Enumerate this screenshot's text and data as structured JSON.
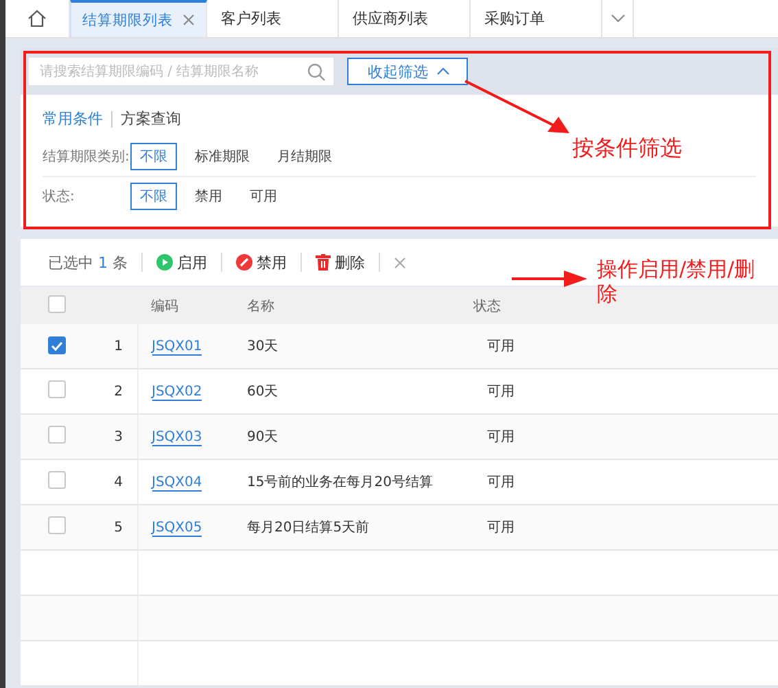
{
  "tabs": [
    {
      "label": "结算期限列表",
      "selected": true,
      "closable": true
    },
    {
      "label": "客户列表",
      "selected": false,
      "closable": false
    },
    {
      "label": "供应商列表",
      "selected": false,
      "closable": false
    },
    {
      "label": "采购订单",
      "selected": false,
      "closable": false
    }
  ],
  "search": {
    "placeholder": "请搜索结算期限编码 / 结算期限名称"
  },
  "collapse_button": "收起筛选",
  "filter_tabs": [
    {
      "label": "常用条件",
      "selected": true
    },
    {
      "label": "方案查询",
      "selected": false
    }
  ],
  "filters": [
    {
      "label": "结算期限类别:",
      "options": [
        {
          "label": "不限",
          "selected": true
        },
        {
          "label": "标准期限",
          "selected": false
        },
        {
          "label": "月结期限",
          "selected": false
        }
      ]
    },
    {
      "label": "状态:",
      "options": [
        {
          "label": "不限",
          "selected": true
        },
        {
          "label": "禁用",
          "selected": false
        },
        {
          "label": "可用",
          "selected": false
        }
      ]
    }
  ],
  "selection": {
    "prefix": "已选中",
    "count": "1",
    "suffix": "条"
  },
  "actions": [
    {
      "kind": "enable",
      "label": "启用"
    },
    {
      "kind": "disable",
      "label": "禁用"
    },
    {
      "kind": "delete",
      "label": "删除"
    }
  ],
  "table": {
    "all_selected": false,
    "columns": [
      "编码",
      "名称",
      "状态"
    ],
    "rows": [
      {
        "index": "1",
        "code": "JSQX01",
        "name": "30天",
        "status": "可用",
        "checked": true
      },
      {
        "index": "2",
        "code": "JSQX02",
        "name": "60天",
        "status": "可用",
        "checked": false
      },
      {
        "index": "3",
        "code": "JSQX03",
        "name": "90天",
        "status": "可用",
        "checked": false
      },
      {
        "index": "4",
        "code": "JSQX04",
        "name": "15号前的业务在每月20号结算",
        "status": "可用",
        "checked": false
      },
      {
        "index": "5",
        "code": "JSQX05",
        "name": "每月20日结算5天前",
        "status": "可用",
        "checked": false
      }
    ]
  },
  "annotations": [
    {
      "text": "按条件筛选"
    },
    {
      "text": "操作启用/禁用/删除"
    }
  ]
}
